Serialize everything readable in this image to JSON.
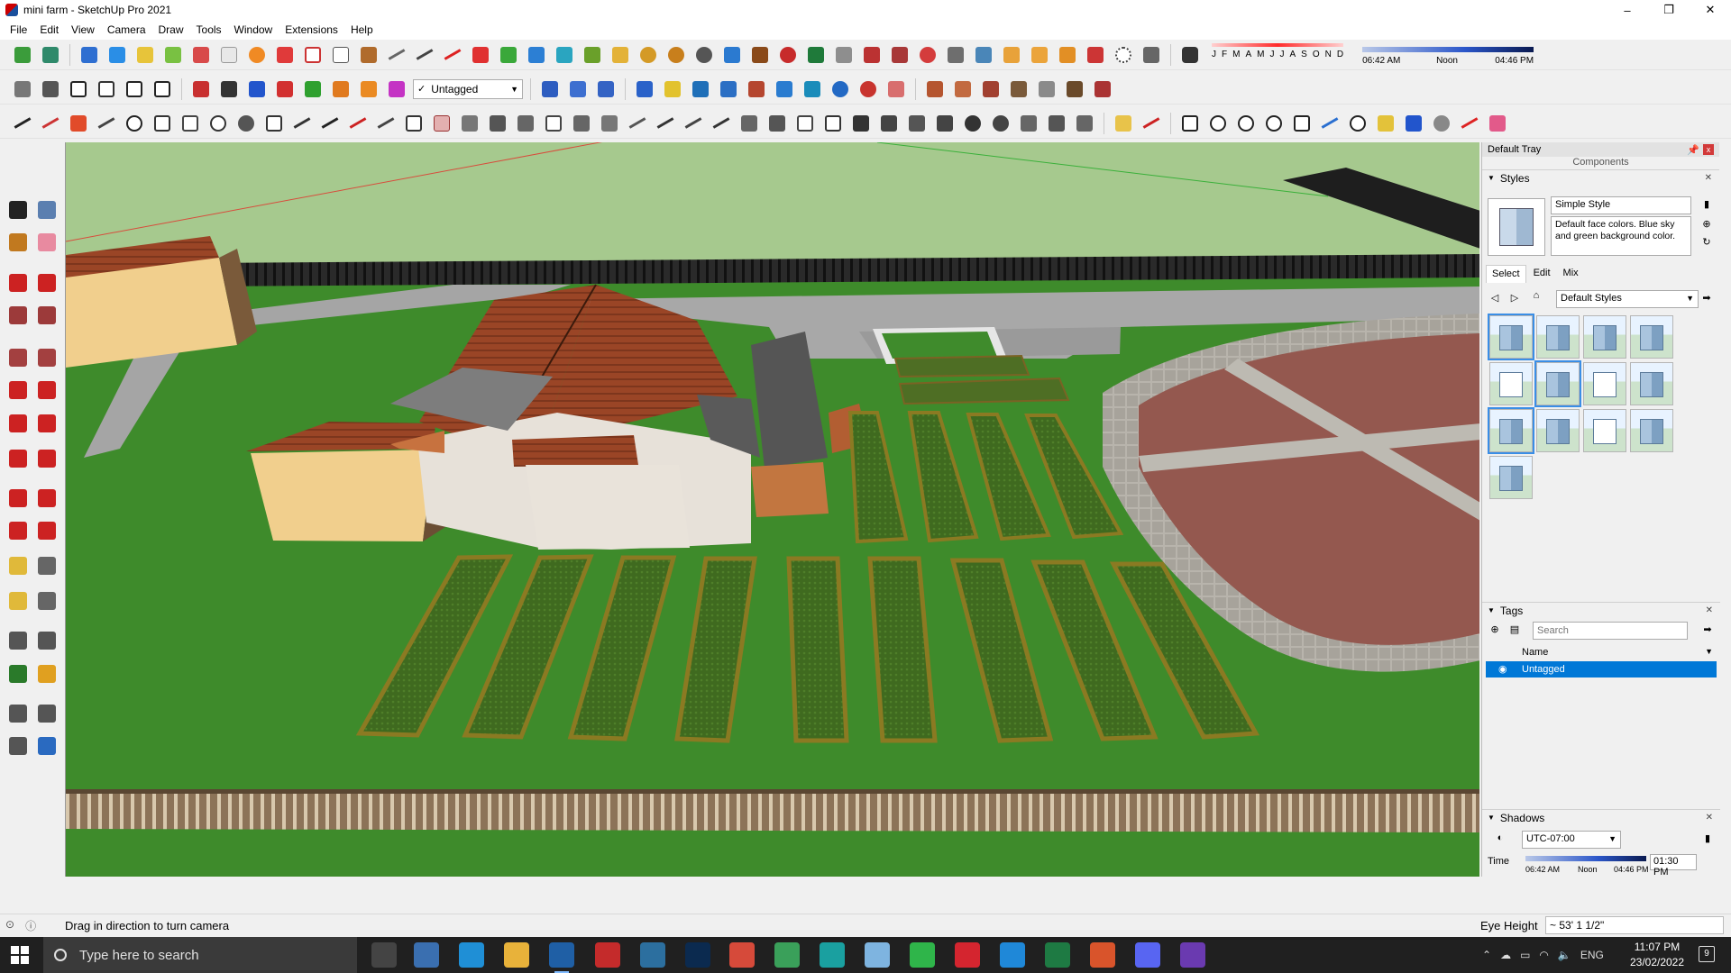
{
  "window": {
    "title": "mini farm - SketchUp Pro 2021",
    "minimize": "–",
    "maximize": "❐",
    "close": "✕"
  },
  "menu": [
    "File",
    "Edit",
    "View",
    "Camera",
    "Draw",
    "Tools",
    "Window",
    "Extensions",
    "Help"
  ],
  "toolbar": {
    "tag_selected": "Untagged",
    "months": [
      "J",
      "F",
      "M",
      "A",
      "M",
      "J",
      "J",
      "A",
      "S",
      "O",
      "N",
      "D"
    ],
    "time_start": "06:42 AM",
    "time_mid": "Noon",
    "time_end": "04:46 PM"
  },
  "tray": {
    "title": "Default Tray",
    "components_label": "Components",
    "styles": {
      "header": "Styles",
      "name": "Simple Style",
      "description": "Default face colors. Blue sky and green background color.",
      "tabs": [
        "Select",
        "Edit",
        "Mix"
      ],
      "library": "Default Styles",
      "thumb_count": 13
    },
    "tags": {
      "header": "Tags",
      "search_placeholder": "Search",
      "col_name": "Name",
      "rows": [
        "Untagged"
      ]
    },
    "shadows": {
      "header": "Shadows",
      "timezone": "UTC-07:00",
      "time_label": "Time",
      "time_start": "06:42 AM",
      "time_mid": "Noon",
      "time_end": "04:46 PM",
      "time_value": "01:30 PM"
    }
  },
  "status": {
    "hint": "Drag in direction to turn camera",
    "eye_label": "Eye Height",
    "eye_value": "~ 53' 1 1/2\""
  },
  "taskbar": {
    "search_placeholder": "Type here to search",
    "lang": "ENG",
    "time": "11:07 PM",
    "date": "23/02/2022",
    "notifications": "9",
    "apps": [
      "task-view",
      "calculator",
      "edge",
      "file-explorer",
      "sketchup",
      "acrobat",
      "snipping",
      "photoshop",
      "chrome",
      "chrome-2",
      "layout",
      "style-builder",
      "whatsapp",
      "opera",
      "vscode",
      "excel",
      "grammarly",
      "discord",
      "podcast"
    ]
  },
  "colors": {
    "sky": "#a9cf8f",
    "ground": "#3f8c2c",
    "roof": "#a04a2a",
    "selection": "#0078d7"
  }
}
